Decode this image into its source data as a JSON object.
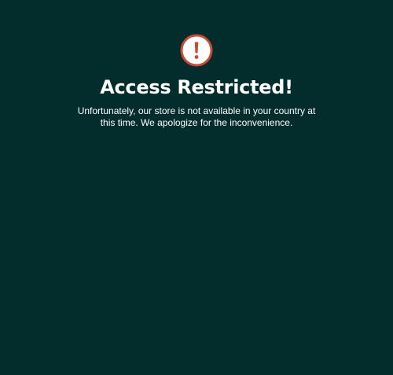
{
  "notice": {
    "icon": "exclamation-circle-icon",
    "icon_colors": {
      "ring": "#c94a35",
      "fill": "#ffffff",
      "mark": "#c94a35"
    },
    "title": "Access Restricted!",
    "message": "Unfortunately, our store is not available in your country at this time. We apologize for the inconvenience."
  },
  "colors": {
    "background": "#032d2d",
    "text": "#ffffff"
  }
}
